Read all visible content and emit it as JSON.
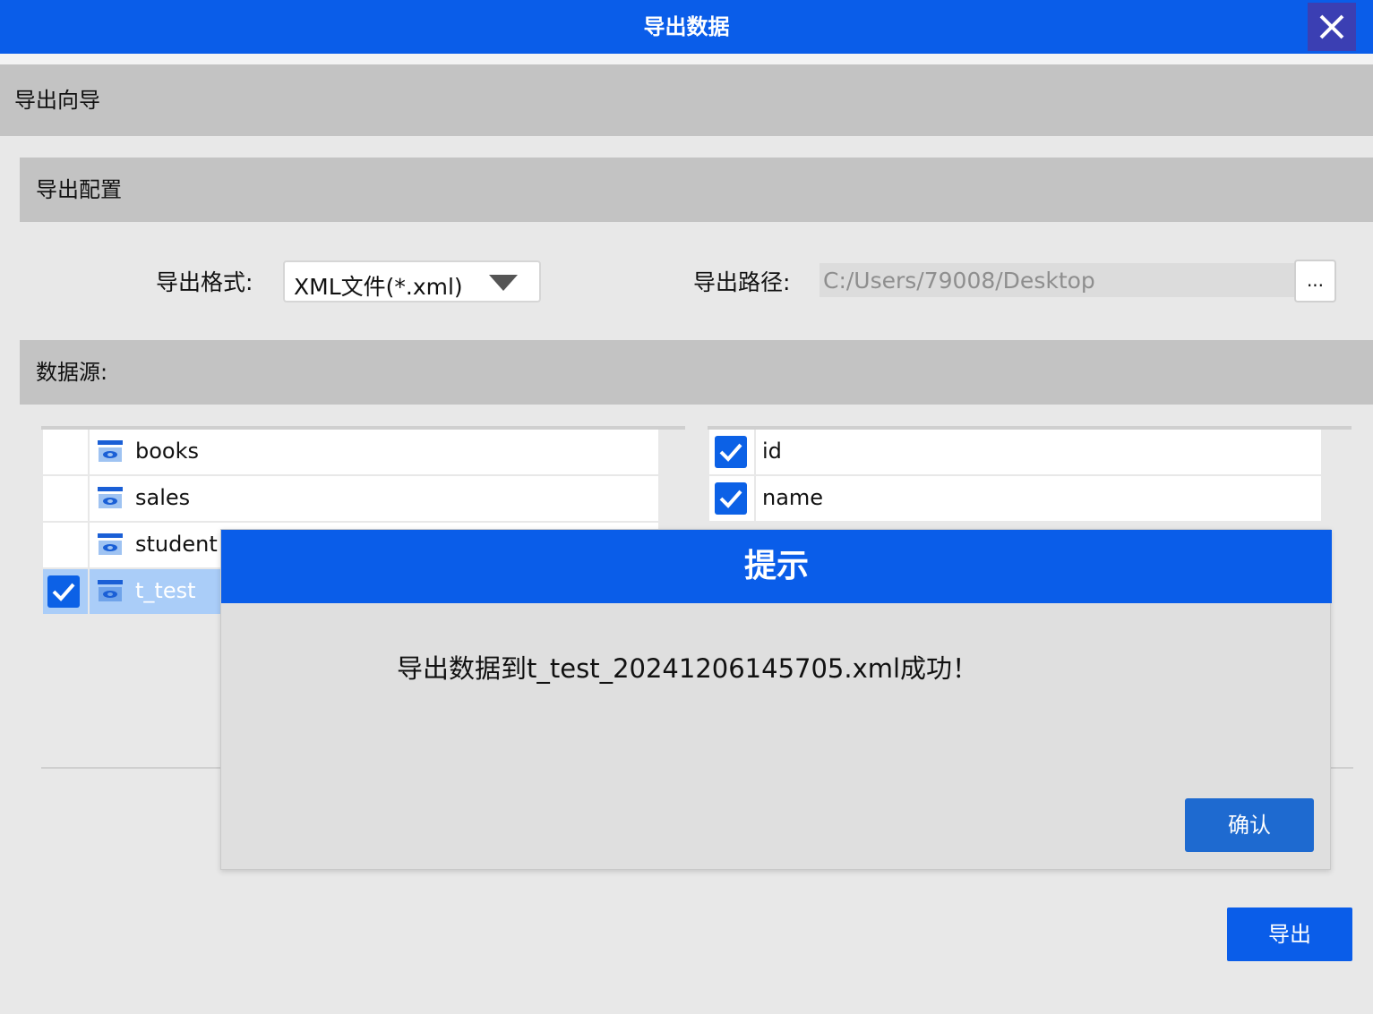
{
  "window": {
    "title": "导出数据",
    "close_icon": "close-icon"
  },
  "wizard": {
    "header": "导出向导"
  },
  "config": {
    "header": "导出配置",
    "format_label": "导出格式:",
    "format_value": "XML文件(*.xml)",
    "path_label": "导出路径:",
    "path_value": "C:/Users/79008/Desktop",
    "browse_label": "..."
  },
  "datasource": {
    "header": "数据源:",
    "tables": [
      {
        "name": "books",
        "checked": false,
        "selected": false
      },
      {
        "name": "sales",
        "checked": false,
        "selected": false
      },
      {
        "name": "student",
        "checked": false,
        "selected": false
      },
      {
        "name": "t_test",
        "checked": true,
        "selected": true
      }
    ],
    "columns": [
      {
        "name": "id",
        "checked": true
      },
      {
        "name": "name",
        "checked": true
      }
    ]
  },
  "actions": {
    "export_label": "导出"
  },
  "dialog": {
    "title": "提示",
    "message": "导出数据到t_test_20241206145705.xml成功！",
    "confirm_label": "确认"
  },
  "colors": {
    "accent": "#0a5de9",
    "selected_row": "#aacdf8",
    "section_bg": "#c3c3c3"
  }
}
